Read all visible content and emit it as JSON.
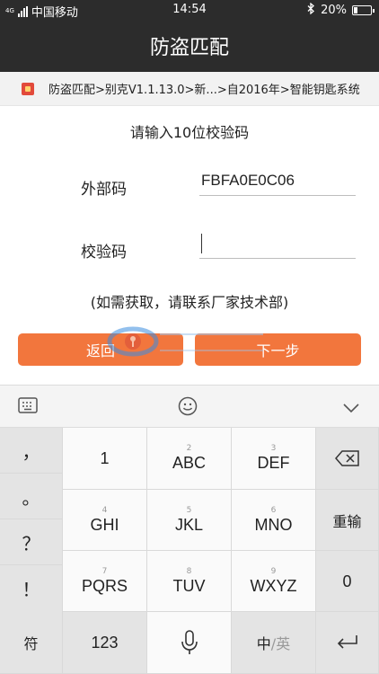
{
  "status_bar": {
    "network": "4G",
    "carrier": "中国移动",
    "time": "14:54",
    "battery": "20%"
  },
  "title": "防盗匹配",
  "breadcrumb": "防盗匹配>别克V1.1.13.0>新...>自2016年>智能钥匙系统",
  "prompt": "请输入10位校验码",
  "external_code": {
    "label": "外部码",
    "value": "FBFA0E0C06"
  },
  "check_code": {
    "label": "校验码",
    "value": ""
  },
  "hint": "(如需获取，请联系厂家技术部)",
  "buttons": {
    "back": "返回",
    "next": "下一步"
  },
  "colors": {
    "accent": "#f2763d",
    "bar": "#2c2c2c"
  },
  "keyboard": {
    "punctuation": [
      "，",
      "。",
      "？",
      "！"
    ],
    "row1": [
      {
        "num": "",
        "main": "1"
      },
      {
        "num": "2",
        "main": "ABC"
      },
      {
        "num": "3",
        "main": "DEF"
      }
    ],
    "row2": [
      {
        "num": "4",
        "main": "GHI"
      },
      {
        "num": "5",
        "main": "JKL"
      },
      {
        "num": "6",
        "main": "MNO"
      }
    ],
    "row3": [
      {
        "num": "7",
        "main": "PQRS"
      },
      {
        "num": "8",
        "main": "TUV"
      },
      {
        "num": "9",
        "main": "WXYZ"
      }
    ],
    "retype": "重输",
    "zero": "0",
    "symbols": "符",
    "numbers": "123",
    "lang_zh": "中",
    "lang_en": "/英"
  }
}
